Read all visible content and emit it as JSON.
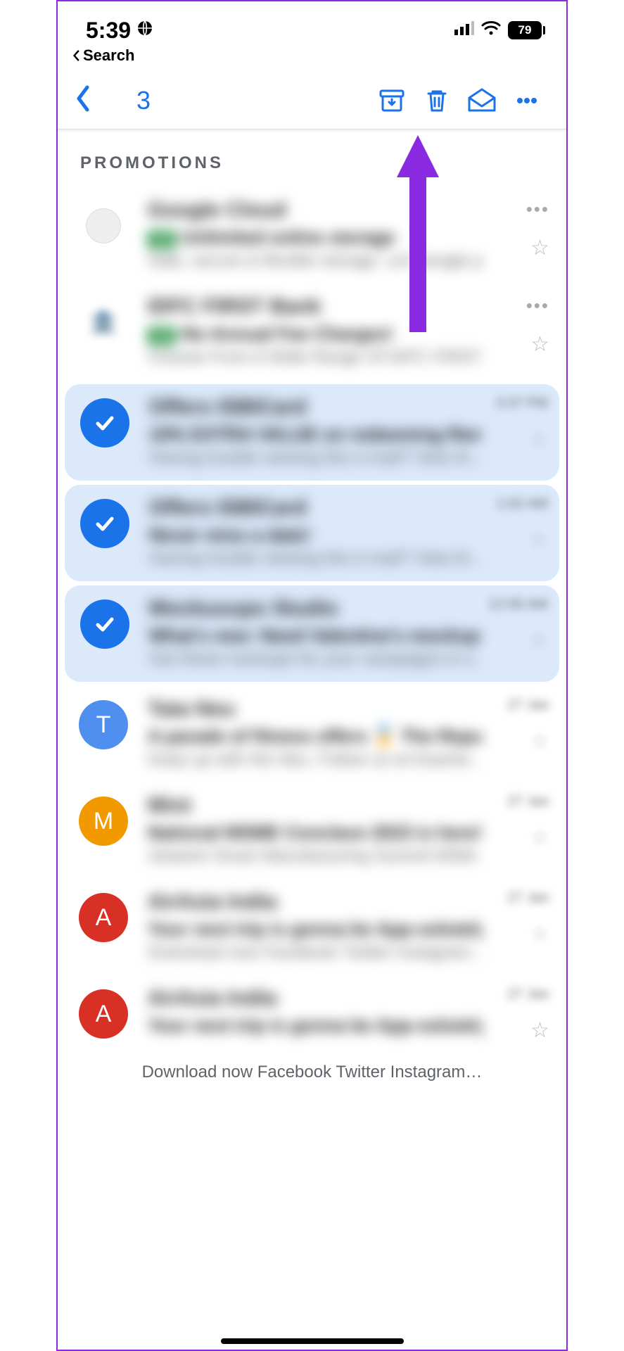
{
  "status": {
    "time": "5:39",
    "battery": "79",
    "breadcrumb_back": "Search"
  },
  "toolbar": {
    "selection_count": "3"
  },
  "section": {
    "label": "PROMOTIONS"
  },
  "emails": [
    {
      "sender": "Google Cloud",
      "subject": "Unlimited online storage",
      "preview": "Safe, secure & flexible storage. Let Google p…",
      "time": "",
      "avatar": "gcloud",
      "selected": false,
      "ad": true
    },
    {
      "sender": "IDFC FIRST Bank",
      "subject": "No Annual Fee Charges!",
      "preview": "Choose From A Wide Range Of IDFC FIRST…",
      "time": "",
      "avatar": "bank",
      "selected": false,
      "ad": true
    },
    {
      "sender": "Offers ISBICard",
      "subject": "10% EXTRA VALUE on redeeming Reward P…",
      "preview": "Having trouble viewing this e-mail? View th…",
      "time": "3:37 PM",
      "avatar": "check",
      "selected": true,
      "ad": false
    },
    {
      "sender": "Offers ISBICard",
      "subject": "Never miss a date!",
      "preview": "Having trouble viewing this e-mail? View th…",
      "time": "1:02 AM",
      "avatar": "check",
      "selected": true,
      "ad": false
    },
    {
      "sender": "Mockuuups Studio",
      "subject": "What's new: Need Valentine's mockups f…",
      "preview": "Get these mockups for your campaigns in s…",
      "time": "12:05 AM",
      "avatar": "check",
      "selected": true,
      "ad": false
    },
    {
      "sender": "Tata Neu",
      "subject": "A parade of fitness offers 🏅 The Republi…",
      "preview": "Keep up with the Neu. Follow us at Downlo…",
      "time": "27 Jan",
      "avatar": "T",
      "selected": false,
      "ad": false
    },
    {
      "sender": "Mint",
      "subject": "National MSME Conclave 2023 is here!",
      "preview": "Zetwerk Smart Manufacturing Summit MSM…",
      "time": "27 Jan",
      "avatar": "M",
      "selected": false,
      "ad": false
    },
    {
      "sender": "AirAsia India",
      "subject": "Your next trip is gonna be App-solutely Fant…",
      "preview": "Download now Facebook Twitter Instagram…",
      "time": "27 Jan",
      "avatar": "A",
      "selected": false,
      "ad": false
    },
    {
      "sender": "AirAsia India",
      "subject": "Your next trip is gonna be App-solutely Fant…",
      "preview": "Download now Facebook Twitter Instagram…",
      "time": "27 Jan",
      "avatar": "A",
      "selected": false,
      "ad": false
    }
  ],
  "caption": "Download now Facebook Twitter Instagram…",
  "icons": {
    "globe": "globe-icon",
    "signal": "signal-icon",
    "wifi": "wifi-icon",
    "battery": "battery-icon",
    "back": "back-icon",
    "archive": "archive-icon",
    "trash": "trash-icon",
    "mark_read": "mark-read-icon",
    "more": "more-icon",
    "star": "star-icon",
    "check": "check-icon"
  },
  "colors": {
    "accent": "#1a73e8",
    "selection_bg": "#dbe9fb",
    "arrow": "#8a2be2"
  }
}
